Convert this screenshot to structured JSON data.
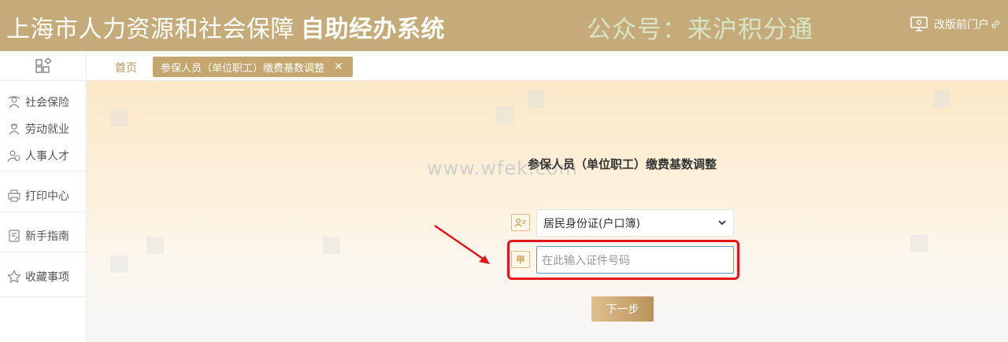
{
  "header": {
    "title_main": "上海市人力资源和社会保障",
    "title_bold": "自助经办系统",
    "watermark": "公众号：来沪积分通",
    "portal_link": "改版前门户"
  },
  "sidebar": {
    "items": [
      {
        "label": "社会保险",
        "icon": "shield-person-icon"
      },
      {
        "label": "劳动就业",
        "icon": "worker-icon"
      },
      {
        "label": "人事人才",
        "icon": "people-icon"
      },
      {
        "label": "打印中心",
        "icon": "printer-icon"
      },
      {
        "label": "新手指南",
        "icon": "guide-icon"
      },
      {
        "label": "收藏事项",
        "icon": "star-icon"
      }
    ]
  },
  "tabs": {
    "home": "首页",
    "active": "参保人员（单位职工）缴费基数调整"
  },
  "main": {
    "site_watermark": "www.wfek.com",
    "form_title": "参保人员（单位职工）缴费基数调整",
    "id_type_selected": "居民身份证(户口簿)",
    "id_number_placeholder": "在此输入证件号码",
    "next_button": "下一步"
  },
  "colors": {
    "header_bg": "#c6ab7a",
    "accent": "#c6a56f",
    "highlight": "#e8141b"
  }
}
